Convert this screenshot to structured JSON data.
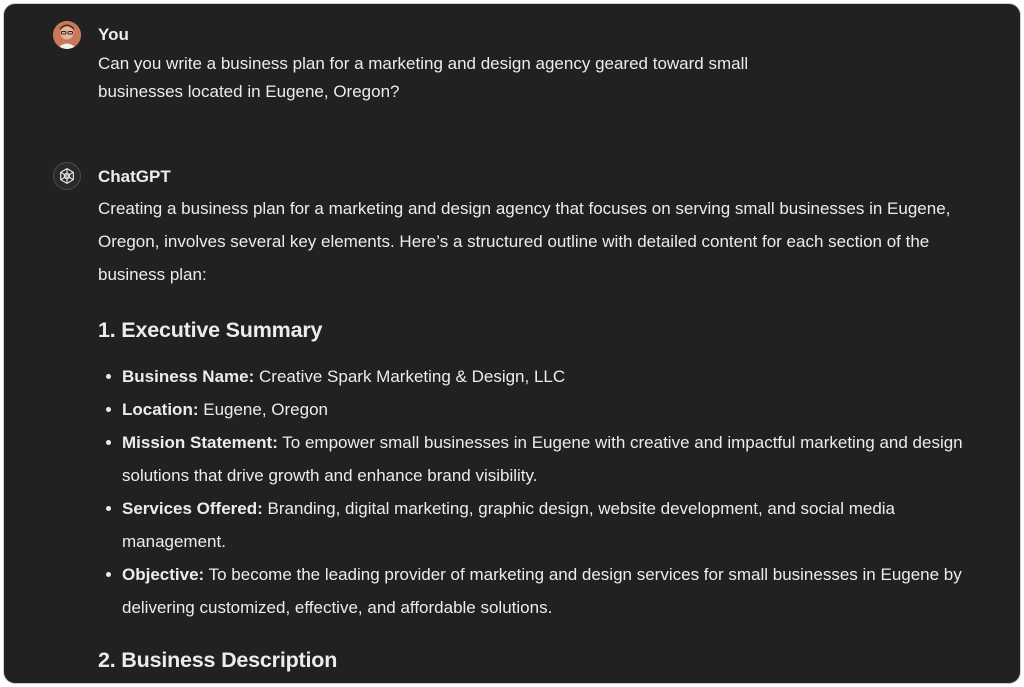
{
  "user_message": {
    "author": "You",
    "text": "Can you write a business plan for a marketing and design agency geared toward small businesses located in Eugene, Oregon?"
  },
  "assistant_message": {
    "author": "ChatGPT",
    "intro": "Creating a business plan for a marketing and design agency that focuses on serving small businesses in Eugene, Oregon, involves several key elements. Here’s a structured outline with detailed content for each section of the business plan:",
    "sections": [
      {
        "heading": "1. Executive Summary",
        "items": [
          {
            "label": "Business Name:",
            "text": "Creative Spark Marketing & Design, LLC"
          },
          {
            "label": "Location:",
            "text": "Eugene, Oregon"
          },
          {
            "label": "Mission Statement:",
            "text": "To empower small businesses in Eugene with creative and impactful marketing and design solutions that drive growth and enhance brand visibility."
          },
          {
            "label": "Services Offered:",
            "text": "Branding, digital marketing, graphic design, website development, and social media management."
          },
          {
            "label": "Objective:",
            "text": "To become the leading provider of marketing and design services for small businesses in Eugene by delivering customized, effective, and affordable solutions."
          }
        ]
      },
      {
        "heading": "2. Business Description",
        "items": []
      }
    ]
  },
  "icons": {
    "user_avatar": "user-avatar-photo",
    "assistant_avatar": "openai-logo-icon"
  },
  "colors": {
    "background": "#212121",
    "text": "#ececec"
  }
}
